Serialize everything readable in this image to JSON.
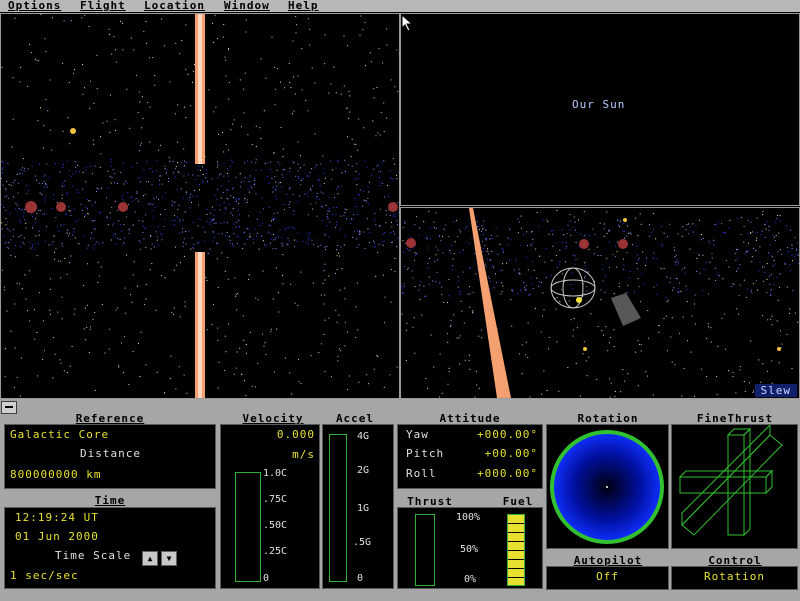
{
  "menu": [
    "Options",
    "Flight",
    "Location",
    "Window",
    "Help"
  ],
  "views": {
    "sun_label": "Our Sun",
    "slew_label": "Slew"
  },
  "reference": {
    "title": "Reference",
    "target": "Galactic Core",
    "distance_label": "Distance",
    "distance": "800000000 km"
  },
  "time": {
    "title": "Time",
    "clock": "12:19:24 UT",
    "date": "01 Jun 2000",
    "scale_label": "Time Scale",
    "scale": "1 sec/sec"
  },
  "velocity": {
    "title": "Velocity",
    "value": "0.000",
    "unit": "m/s",
    "ticks": [
      "1.0C",
      ".75C",
      ".50C",
      ".25C",
      "0"
    ],
    "level": 0
  },
  "accel": {
    "title": "Accel",
    "ticks": [
      "4G",
      "2G",
      "1G",
      ".5G",
      "0"
    ],
    "level": 0
  },
  "attitude": {
    "title": "Attitude",
    "yaw_label": "Yaw",
    "yaw": "+000.00°",
    "pitch_label": "Pitch",
    "pitch": "+00.00°",
    "roll_label": "Roll",
    "roll": "+000.00°"
  },
  "thrust": {
    "title": "Thrust",
    "level": 0
  },
  "fuel": {
    "title": "Fuel",
    "ticks": [
      "100%",
      "50%",
      "0%"
    ],
    "level": 1
  },
  "rotation": {
    "title": "Rotation"
  },
  "finethrust": {
    "title": "FineThrust"
  },
  "autopilot": {
    "title": "Autopilot",
    "value": "Off"
  },
  "control": {
    "title": "Control",
    "value": "Rotation"
  },
  "colors": {
    "accent_yellow": "#e8e030",
    "gauge_green": "#30b030",
    "panel_gray": "#a6a6a6"
  }
}
